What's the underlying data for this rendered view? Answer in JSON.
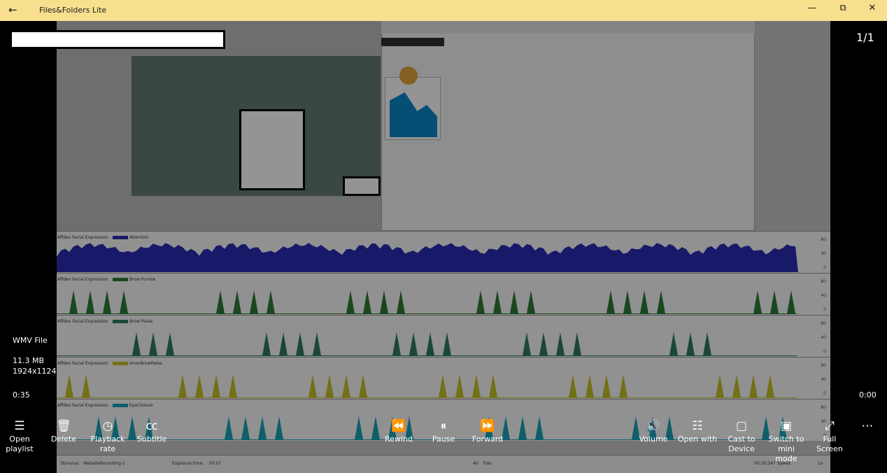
{
  "window": {
    "title": "Files&Folders Lite",
    "back_icon": "←",
    "min_icon": "—",
    "restore_icon": "⧉",
    "close_icon": "✕"
  },
  "viewer": {
    "counter": "1/1",
    "file_type": "WMV File",
    "file_size": "11.3 MB",
    "dimensions": "1924x1124",
    "elapsed": "0:35",
    "remaining": "0:00"
  },
  "controls": {
    "open_playlist": "Open playlist",
    "delete": "Delete",
    "playback_rate": "Playback rate",
    "subtitle": "Subtitle",
    "rewind": "Rewind",
    "pause": "Pause",
    "forward": "Forward",
    "volume": "Volume",
    "open_with": "Open with",
    "cast": "Cast to Device",
    "mini_mode": "Switch to mini mode",
    "full_screen": "Full Screen",
    "more": "⋯"
  },
  "video_content": {
    "rows": [
      {
        "label": "Affdex Facial Expression",
        "series": "Attention",
        "color": "#2b2bb5"
      },
      {
        "label": "Affdex Facial Expression",
        "series": "Brow Furrow",
        "color": "#2e7d32"
      },
      {
        "label": "Affdex Facial Expression",
        "series": "Brow Raise",
        "color": "#2e7d5a"
      },
      {
        "label": "Affdex Facial Expression",
        "series": "InnerBrowRaise",
        "color": "#c9c12a"
      },
      {
        "label": "Affdex Facial Expression",
        "series": "EyeClosure",
        "color": "#1ba3b8"
      }
    ],
    "ticks": [
      "80",
      "40",
      "0"
    ],
    "footer": {
      "stimulus_label": "Stimulus:",
      "stimulus": "WebsiteRecording-1",
      "exposure_label": "Exposure time:",
      "exposure": "00:07",
      "count": "40",
      "person": "fran",
      "time": "00:35:247",
      "speed_label": "Speed",
      "speed": "1x"
    }
  }
}
